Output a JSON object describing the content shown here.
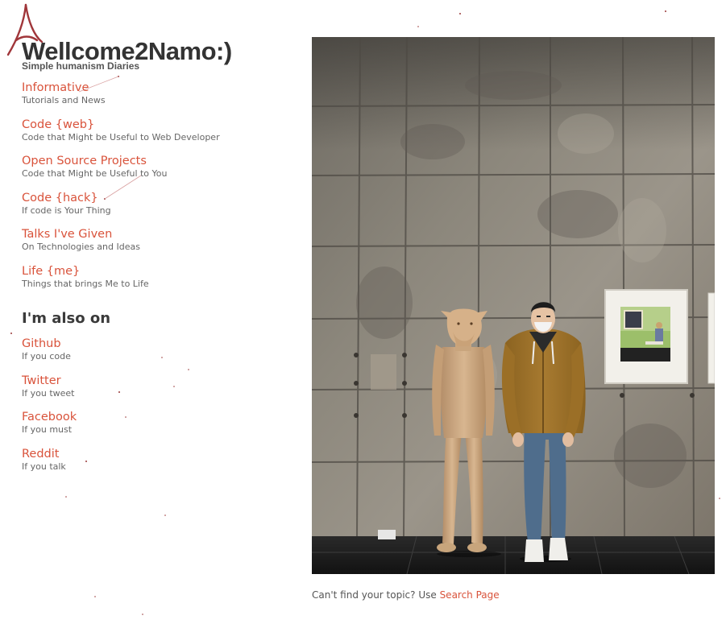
{
  "header": {
    "title": "Wellcome2Namo:)",
    "tagline": "Simple humanism Diaries"
  },
  "nav": {
    "items": [
      {
        "label": "Informative",
        "desc": "Tutorials and News"
      },
      {
        "label": "Code {web}",
        "desc": "Code that Might be Useful to Web Developer"
      },
      {
        "label": "Open Source Projects",
        "desc": "Code that Might be Useful to You"
      },
      {
        "label": "Code {hack}",
        "desc": "If code is Your Thing"
      },
      {
        "label": "Talks I've Given",
        "desc": "On Technologies and Ideas"
      },
      {
        "label": "Life {me}",
        "desc": "Things that brings Me to Life"
      }
    ]
  },
  "social": {
    "heading": "I'm also on",
    "items": [
      {
        "label": "Github",
        "desc": "If you code"
      },
      {
        "label": "Twitter",
        "desc": "If you tweet"
      },
      {
        "label": "Facebook",
        "desc": "If you must"
      },
      {
        "label": "Reddit",
        "desc": "If you talk"
      }
    ]
  },
  "footer": {
    "text": "Can't find your topic? Use ",
    "link_label": "Search Page"
  },
  "icons": {
    "logo": "eiffel-tower-icon"
  },
  "colors": {
    "accent": "#d9533b",
    "title": "#333333",
    "muted": "#666666",
    "logo": "#a0363a"
  }
}
